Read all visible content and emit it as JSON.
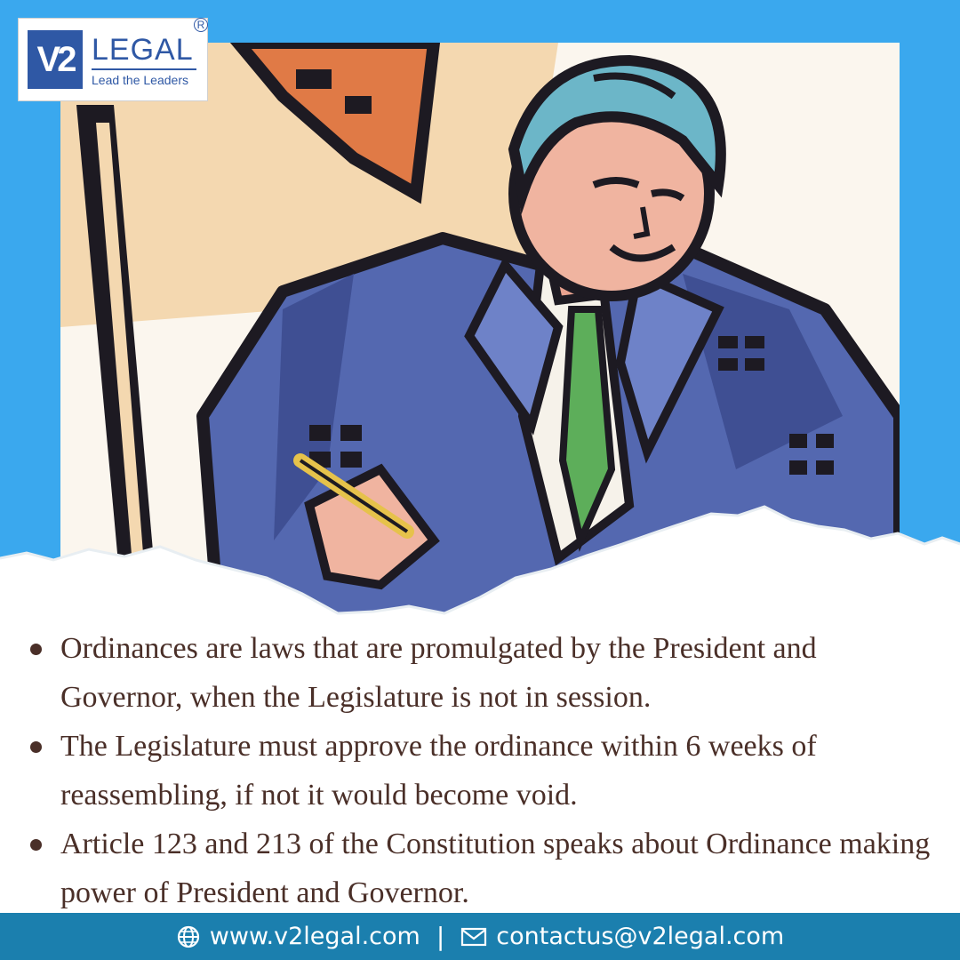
{
  "brand": {
    "logo_mark": "V2",
    "name": "LEGAL",
    "tagline": "Lead the Leaders",
    "registered": "R"
  },
  "illustration": {
    "icon": "man-signing-document-illustration"
  },
  "bullets": [
    "Ordinances are laws that are promulgated by the President and Governor, when the Legislature is not in session.",
    "The Legislature must approve the ordinance within 6 weeks of reassembling, if not it would become void.",
    "Article 123 and 213 of the Constitution speaks about Ordinance making power of President and Governor."
  ],
  "footer": {
    "website_icon": "globe-icon",
    "website": "www.v2legal.com",
    "separator": "|",
    "email_icon": "mail-icon",
    "email": "contactus@v2legal.com"
  },
  "colors": {
    "background_blue": "#3aa8ee",
    "footer_blue": "#1b7fae",
    "text_brown": "#4a2f28",
    "logo_blue": "#2f58a5"
  }
}
